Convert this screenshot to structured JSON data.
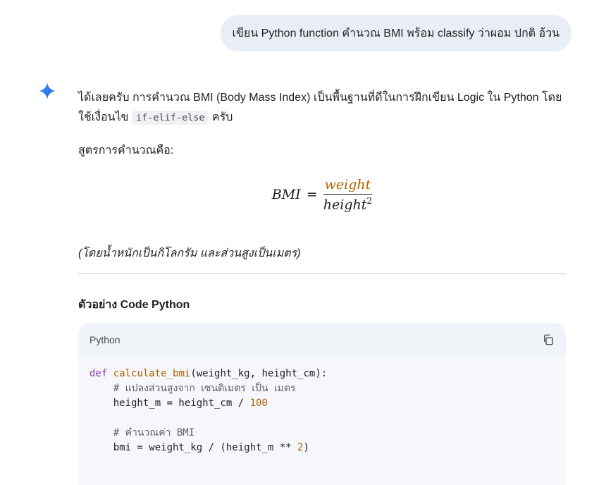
{
  "user_prompt": "เขียน Python function คำนวณ BMI พร้อม classify ว่าผอม ปกติ อ้วน",
  "response": {
    "intro_part1": "ได้เลยครับ การคำนวณ BMI (Body Mass Index) เป็นพื้นฐานที่ดีในการฝึกเขียน Logic ใน Python โดยใช้เงื่อนไข ",
    "intro_code": "if-elif-else",
    "intro_part2": " ครับ",
    "formula_intro": "สูตรการคำนวณคือ:",
    "formula": {
      "lhs": "BMI",
      "eq": "=",
      "numerator": "weight",
      "denominator": "height",
      "exponent": "2"
    },
    "note": "(โดยน้ำหนักเป็นกิโลกรัม และส่วนสูงเป็นเมตร)",
    "section_heading": "ตัวอย่าง Code Python",
    "code_block": {
      "language": "Python",
      "lines": {
        "l1_kw": "def",
        "l1_fn": "calculate_bmi",
        "l1_rest": "(weight_kg, height_cm):",
        "l2": "    # แปลงส่วนสูงจาก เซนติเมตร เป็น เมตร",
        "l3_code": "    height_m = height_cm / ",
        "l3_num": "100",
        "l5": "    # คำนวณค่า BMI",
        "l6_code": "    bmi = weight_kg / (height_m ** ",
        "l6_num": "2",
        "l6_end": ")"
      }
    }
  },
  "icons": {
    "assistant": "sparkle-icon",
    "copy": "copy-icon"
  },
  "colors": {
    "accent": "#4285f4",
    "bubble": "#e9eef6",
    "code_bg": "#f0f4f9"
  }
}
